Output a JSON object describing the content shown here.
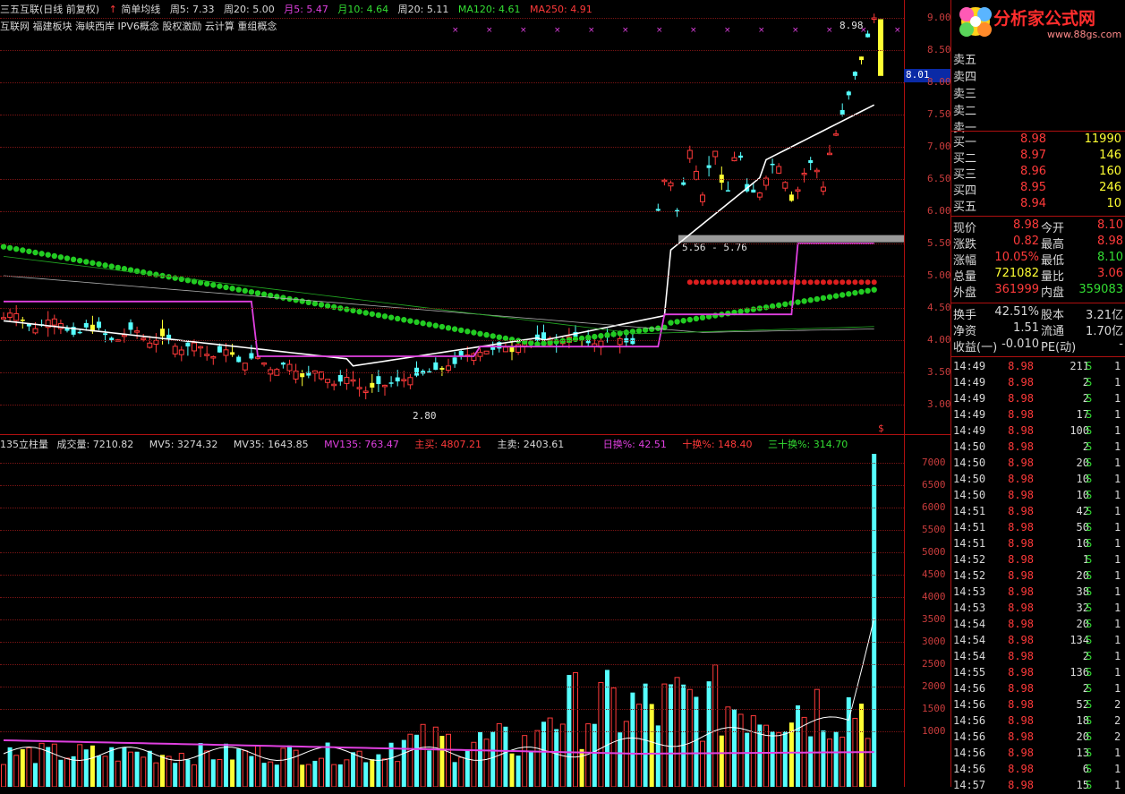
{
  "header": {
    "stock": "三五互联(日线 前复权)",
    "indicator": "简单均线",
    "ma5": "周5: 7.33",
    "ma20w": "周20: 5.00",
    "m5": "月5: 5.47",
    "m10": "月10: 4.64",
    "m20": "周20: 5.11",
    "ma120": "MA120: 4.61",
    "ma250": "MA250: 4.91",
    "concepts": "互联网 福建板块 海峡西岸 IPV6概念 股权激励 云计算 重组概念"
  },
  "colors": {
    "up": "#ff3a3a",
    "down": "#55ffff",
    "yellow": "#ffff33",
    "green": "#33dd33",
    "magenta": "#e040e0",
    "axis": "#c83c3c"
  },
  "price_axis": [
    "9.00",
    "8.50",
    "8.00",
    "7.50",
    "7.00",
    "6.50",
    "6.00",
    "5.50",
    "5.00",
    "4.50",
    "4.00",
    "3.50",
    "3.00"
  ],
  "vol_axis": [
    "7000",
    "6500",
    "6000",
    "5500",
    "5000",
    "4500",
    "4000",
    "3500",
    "3000",
    "2500",
    "2000",
    "1500",
    "1000"
  ],
  "current_price_tag": "8.01",
  "annotations": {
    "high": "8.98",
    "low": "2.80",
    "range": "5.56 - 5.76",
    "dollar": "$"
  },
  "volume_header": {
    "name": "135立柱量",
    "vol": "成交量: 7210.82",
    "mv5": "MV5: 3274.32",
    "mv35": "MV35: 1643.85",
    "mv135": "MV135: 763.47",
    "zhumai": "主买: 4807.21",
    "zhumaichu": "主卖: 2403.61",
    "rihuan": "日换%: 42.51",
    "shihuan": "十换%: 148.40",
    "sanshihuan": "三十换%: 314.70"
  },
  "orderbook": {
    "sell": [
      {
        "label": "卖五",
        "price": "",
        "vol": ""
      },
      {
        "label": "卖四",
        "price": "",
        "vol": ""
      },
      {
        "label": "卖三",
        "price": "",
        "vol": ""
      },
      {
        "label": "卖二",
        "price": "",
        "vol": ""
      },
      {
        "label": "卖一",
        "price": "",
        "vol": ""
      }
    ],
    "buy": [
      {
        "label": "买一",
        "price": "8.98",
        "vol": "11990"
      },
      {
        "label": "买二",
        "price": "8.97",
        "vol": "146"
      },
      {
        "label": "买三",
        "price": "8.96",
        "vol": "160"
      },
      {
        "label": "买四",
        "price": "8.95",
        "vol": "246"
      },
      {
        "label": "买五",
        "price": "8.94",
        "vol": "10"
      }
    ]
  },
  "quote": [
    {
      "l1": "现价",
      "v1": "8.98",
      "l2": "今开",
      "v2": "8.10"
    },
    {
      "l1": "涨跌",
      "v1": "0.82",
      "l2": "最高",
      "v2": "8.98"
    },
    {
      "l1": "涨幅",
      "v1": "10.05%",
      "l2": "最低",
      "v2": "8.10"
    },
    {
      "l1": "总量",
      "v1": "721082",
      "l2": "量比",
      "v2": "3.06"
    },
    {
      "l1": "外盘",
      "v1": "361999",
      "l2": "内盘",
      "v2": "359083"
    }
  ],
  "fund": [
    {
      "l1": "换手",
      "v1": "42.51%",
      "l2": "股本",
      "v2": "3.21亿"
    },
    {
      "l1": "净资",
      "v1": "1.51",
      "l2": "流通",
      "v2": "1.70亿"
    },
    {
      "l1": "收益(一)",
      "v1": "-0.010",
      "l2": "PE(动)",
      "v2": "-"
    }
  ],
  "ticks": [
    {
      "t": "14:49",
      "p": "8.98",
      "v": "211",
      "s": "S",
      "n": "1"
    },
    {
      "t": "14:49",
      "p": "8.98",
      "v": "2",
      "s": "S",
      "n": "1"
    },
    {
      "t": "14:49",
      "p": "8.98",
      "v": "2",
      "s": "S",
      "n": "1"
    },
    {
      "t": "14:49",
      "p": "8.98",
      "v": "17",
      "s": "S",
      "n": "1"
    },
    {
      "t": "14:49",
      "p": "8.98",
      "v": "100",
      "s": "S",
      "n": "1"
    },
    {
      "t": "14:50",
      "p": "8.98",
      "v": "2",
      "s": "S",
      "n": "1"
    },
    {
      "t": "14:50",
      "p": "8.98",
      "v": "20",
      "s": "S",
      "n": "1"
    },
    {
      "t": "14:50",
      "p": "8.98",
      "v": "10",
      "s": "S",
      "n": "1"
    },
    {
      "t": "14:50",
      "p": "8.98",
      "v": "10",
      "s": "S",
      "n": "1"
    },
    {
      "t": "14:51",
      "p": "8.98",
      "v": "42",
      "s": "S",
      "n": "1"
    },
    {
      "t": "14:51",
      "p": "8.98",
      "v": "50",
      "s": "S",
      "n": "1"
    },
    {
      "t": "14:51",
      "p": "8.98",
      "v": "10",
      "s": "S",
      "n": "1"
    },
    {
      "t": "14:52",
      "p": "8.98",
      "v": "1",
      "s": "S",
      "n": "1"
    },
    {
      "t": "14:52",
      "p": "8.98",
      "v": "20",
      "s": "S",
      "n": "1"
    },
    {
      "t": "14:53",
      "p": "8.98",
      "v": "38",
      "s": "S",
      "n": "1"
    },
    {
      "t": "14:53",
      "p": "8.98",
      "v": "32",
      "s": "S",
      "n": "1"
    },
    {
      "t": "14:54",
      "p": "8.98",
      "v": "20",
      "s": "S",
      "n": "1"
    },
    {
      "t": "14:54",
      "p": "8.98",
      "v": "134",
      "s": "S",
      "n": "1"
    },
    {
      "t": "14:54",
      "p": "8.98",
      "v": "2",
      "s": "S",
      "n": "1"
    },
    {
      "t": "14:55",
      "p": "8.98",
      "v": "136",
      "s": "S",
      "n": "1"
    },
    {
      "t": "14:56",
      "p": "8.98",
      "v": "2",
      "s": "S",
      "n": "1"
    },
    {
      "t": "14:56",
      "p": "8.98",
      "v": "52",
      "s": "S",
      "n": "2"
    },
    {
      "t": "14:56",
      "p": "8.98",
      "v": "18",
      "s": "S",
      "n": "2"
    },
    {
      "t": "14:56",
      "p": "8.98",
      "v": "20",
      "s": "S",
      "n": "2"
    },
    {
      "t": "14:56",
      "p": "8.98",
      "v": "13",
      "s": "S",
      "n": "1"
    },
    {
      "t": "14:56",
      "p": "8.98",
      "v": "6",
      "s": "S",
      "n": "1"
    },
    {
      "t": "14:57",
      "p": "8.98",
      "v": "15",
      "s": "S",
      "n": "1"
    }
  ],
  "logo": {
    "text": "分析家公式网",
    "url": "www.88gs.com"
  }
}
